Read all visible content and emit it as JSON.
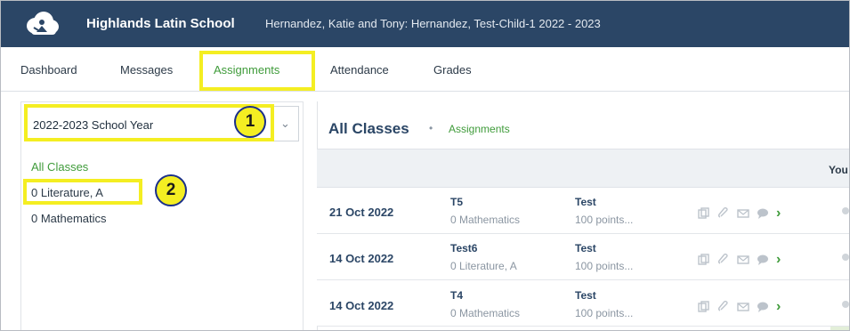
{
  "header": {
    "school_name": "Highlands Latin School",
    "family_name": "Hernandez, Katie and Tony: Hernandez, Test-Child-1 2022 - 2023",
    "logo_icon": "cloud-person-logo-icon"
  },
  "nav": {
    "items": [
      {
        "label": "Dashboard"
      },
      {
        "label": "Messages"
      },
      {
        "label": "Assignments",
        "active": true
      },
      {
        "label": "Attendance"
      },
      {
        "label": "Grades"
      }
    ]
  },
  "sidebar": {
    "year_select": {
      "value": "2022-2023 School Year"
    },
    "classes": [
      {
        "label": "All Classes",
        "active": true
      },
      {
        "label": "0 Literature, A"
      },
      {
        "label": "0 Mathematics"
      }
    ]
  },
  "annotations": {
    "badge_1": "1",
    "badge_2": "2",
    "highlight_color": "#f4ee22"
  },
  "main": {
    "title": "All Classes",
    "separator": "•",
    "subtitle": "Assignments",
    "header_cut_text": "You",
    "rows": [
      {
        "date": "21 Oct 2022",
        "title": "T5",
        "class": "0 Mathematics",
        "category": "Test",
        "points": "100 points..."
      },
      {
        "date": "14 Oct 2022",
        "title": "Test6",
        "class": "0 Literature, A",
        "category": "Test",
        "points": "100 points..."
      },
      {
        "date": "14 Oct 2022",
        "title": "T4",
        "class": "0 Mathematics",
        "category": "Test",
        "points": "100 points..."
      }
    ]
  },
  "colors": {
    "topbar": "#2b4666",
    "accent_green": "#3f9b3a",
    "annotation_yellow": "#f4ee22",
    "badge_border": "#1a2f8a"
  }
}
